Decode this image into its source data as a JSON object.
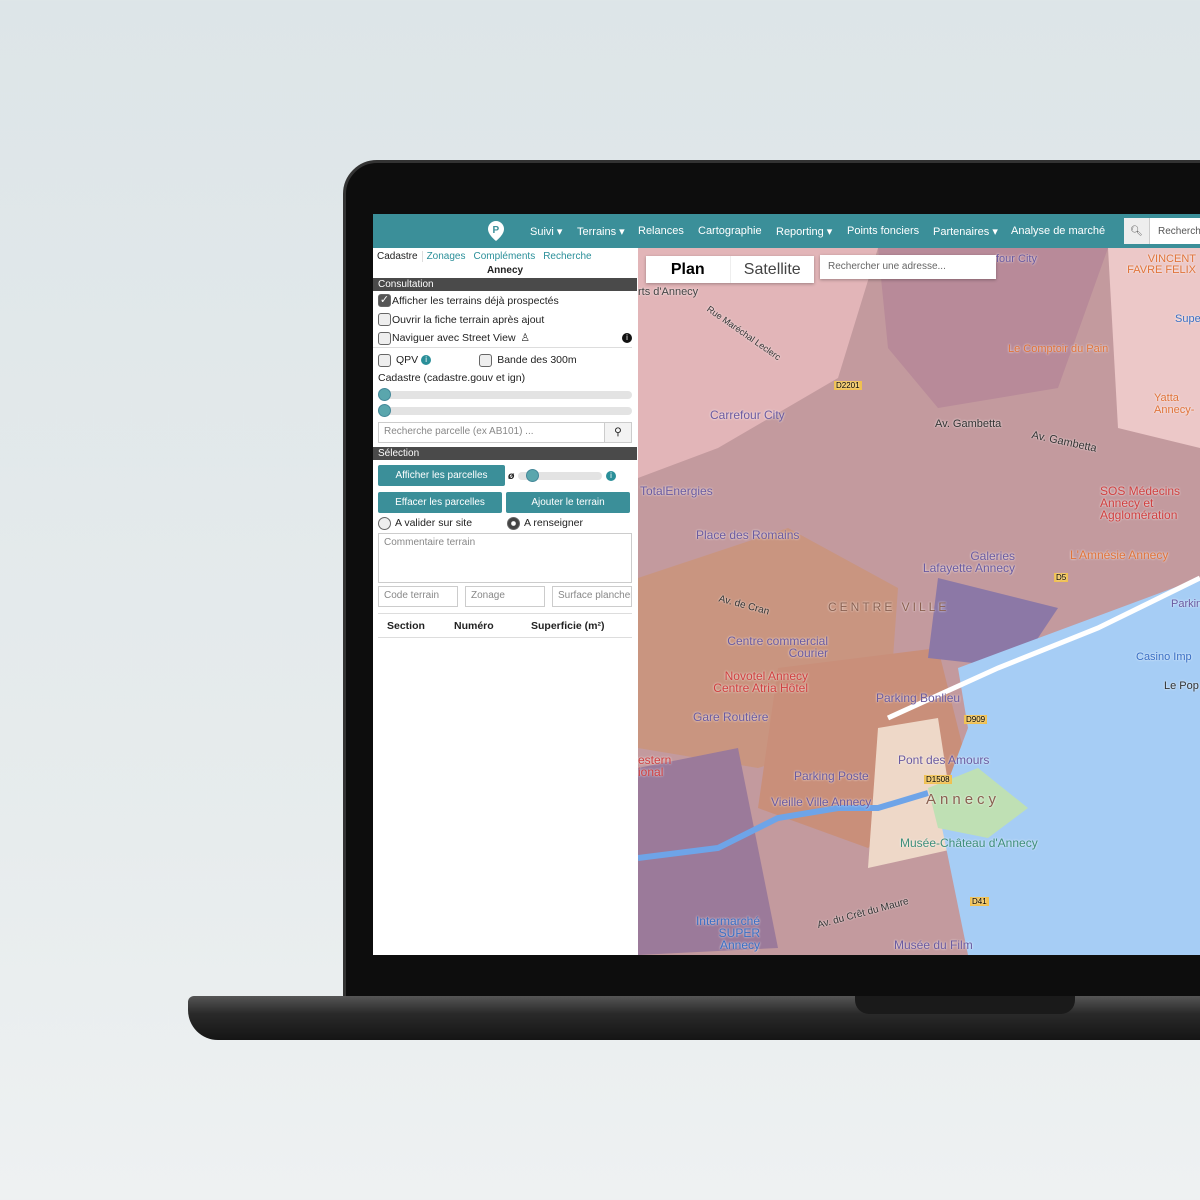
{
  "nav": {
    "items": [
      {
        "label": "Suivi",
        "dropdown": true
      },
      {
        "label": "Terrains",
        "dropdown": true
      },
      {
        "label": "Relances"
      },
      {
        "label": "Cartographie"
      },
      {
        "label": "Reporting",
        "dropdown": true
      },
      {
        "label": "Points fonciers"
      },
      {
        "label": "Partenaires",
        "dropdown": true
      },
      {
        "label": "Analyse de marché"
      }
    ],
    "search_placeholder": "Recherch",
    "brand_color": "#3b8f99"
  },
  "panel": {
    "tabs": [
      "Cadastre",
      "Zonages",
      "Compléments",
      "Recherche"
    ],
    "city": "Annecy",
    "consultation": {
      "title": "Consultation",
      "options": [
        {
          "label": "Afficher les terrains déjà prospectés",
          "checked": true
        },
        {
          "label": "Ouvrir la fiche terrain après ajout",
          "checked": false
        },
        {
          "label": "Naviguer avec Street View",
          "checked": false
        }
      ],
      "qpv": "QPV",
      "bande": "Bande des 300m",
      "cadastre_label": "Cadastre (cadastre.gouv et ign)",
      "parcel_search_placeholder": "Recherche parcelle (ex AB101) ..."
    },
    "selection": {
      "title": "Sélection",
      "show_parcels": "Afficher les parcelles",
      "diameter_symbol": "ø",
      "clear_parcels": "Effacer les parcelles",
      "add_terrain": "Ajouter le terrain",
      "radio_validate": "A valider sur site",
      "radio_fill": "A renseigner",
      "radio_selected": "A renseigner",
      "comment_placeholder": "Commentaire terrain",
      "code_placeholder": "Code terrain",
      "zonage_placeholder": "Zonage",
      "surface_placeholder": "Surface plancher"
    },
    "table_headers": [
      "Section",
      "Numéro",
      "Superficie (m²)"
    ]
  },
  "map": {
    "type_buttons": [
      "Plan",
      "Satellite"
    ],
    "active_type": "Plan",
    "address_placeholder": "Rechercher une adresse...",
    "labels": [
      "four City",
      "VINCENT FAVRE FELIX",
      "rts d'Annecy",
      "Super",
      "Rue Maréchal Leclerc",
      "Le Comptoir du Pain",
      "Carrefour City",
      "Yatta Annecy-",
      "Av. Gambetta",
      "Av. Gambetta",
      "TotalEnergies",
      "SOS Médecins Annecy et Agglomération",
      "Place des Romains",
      "Galeries Lafayette Annecy",
      "L'Amnésie Annecy",
      "CENTRE VILLE",
      "Av. de Cran",
      "Parkin",
      "Centre commercial Courier",
      "Casino Imp",
      "Novotel Annecy Centre Atria Hôtel",
      "Parking Bonlieu",
      "Le Pop",
      "Gare Routière",
      "Pont des Amours",
      "estern ional",
      "Parking Poste",
      "Vieille Ville Annecy",
      "Annecy",
      "Musée-Château d'Annecy",
      "Intermarché SUPER Annecy",
      "Av. du Crêt du Maure",
      "Musée du Film",
      "D2201",
      "D1508",
      "D41",
      "D5",
      "D909"
    ]
  }
}
